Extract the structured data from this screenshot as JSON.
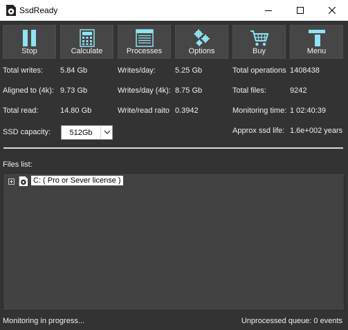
{
  "window": {
    "title": "SsdReady"
  },
  "toolbar": {
    "buttons": [
      {
        "label": "Stop",
        "icon": "pause-icon"
      },
      {
        "label": "Calculate",
        "icon": "calculator-icon"
      },
      {
        "label": "Processes",
        "icon": "list-window-icon"
      },
      {
        "label": "Options",
        "icon": "gears-icon"
      },
      {
        "label": "Buy",
        "icon": "shopping-cart-icon"
      },
      {
        "label": "Menu",
        "icon": "menu-icon"
      }
    ]
  },
  "stats": {
    "total_writes": {
      "label": "Total writes:",
      "value": "5.84 Gb"
    },
    "aligned": {
      "label": "Aligned to (4k):",
      "value": "9.73 Gb"
    },
    "total_read": {
      "label": "Total read:",
      "value": "14.80 Gb"
    },
    "writes_day": {
      "label": "Writes/day:",
      "value": "5.25 Gb"
    },
    "writes_day_4k": {
      "label": "Writes/day (4k):",
      "value": "8.75 Gb"
    },
    "write_read_ratio": {
      "label": "Write/read raito",
      "value": "0.3942"
    },
    "total_operations": {
      "label": "Total operations",
      "value": "1408438"
    },
    "total_files": {
      "label": "Total files:",
      "value": "9242"
    },
    "monitoring_time": {
      "label": "Monitoring time:",
      "value": "1 02:40:39"
    },
    "ssd_capacity": {
      "label": "SSD capacity:",
      "value": "512Gb"
    },
    "ssd_life": {
      "label": "Approx ssd life:",
      "value": "1.6e+002 years"
    }
  },
  "files": {
    "label": "Files list:",
    "items": [
      {
        "label": "C: ( Pro or Sever license )"
      }
    ]
  },
  "status": {
    "left": "Monitoring in progress...",
    "right": "Unprocessed queue: 0 events"
  },
  "colors": {
    "accent": "#8fe3f2",
    "background": "#333333",
    "button": "#464646"
  }
}
